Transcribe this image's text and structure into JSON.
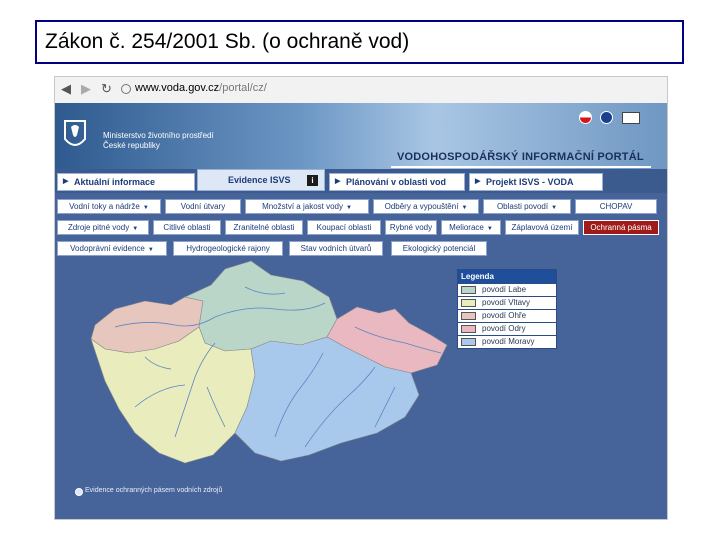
{
  "slide": {
    "title": "Zákon č. 254/2001 Sb. (o ochraně vod)"
  },
  "browser": {
    "address_host": "www.voda.gov.cz",
    "address_path": "/portal/cz/"
  },
  "header": {
    "ministry_line1": "Ministerstvo životního prostředí",
    "ministry_line2": "České republiky",
    "portal_title": "VODOHOSPODÁŘSKÝ INFORMAČNÍ PORTÁL"
  },
  "tabs": [
    {
      "label": "Aktuální informace"
    },
    {
      "label": "Evidence ISVS"
    },
    {
      "label": "Plánování v oblasti vod"
    },
    {
      "label": "Projekt ISVS - VODA"
    }
  ],
  "info_badge": "i",
  "buttons_row1": [
    "Vodní toky a nádrže",
    "Vodní útvary",
    "Množství a jakost vody",
    "Odběry a vypouštění",
    "Oblasti povodí",
    "CHOPAV"
  ],
  "buttons_row2": [
    "Zdroje pitné vody",
    "Citlivé oblasti",
    "Zranitelné oblasti",
    "Koupací oblasti",
    "Rybné vody",
    "Meliorace",
    "Záplavová území",
    "Ochranná pásma"
  ],
  "buttons_row3": [
    "Vodoprávní evidence",
    "Hydrogeologické rajony",
    "Stav vodních útvarů",
    "Ekologický potenciál"
  ],
  "legend": {
    "title": "Legenda",
    "items": [
      {
        "label": "povodí Labe",
        "color": "#b9d6c8"
      },
      {
        "label": "povodí Vltavy",
        "color": "#e9ecbd"
      },
      {
        "label": "povodí Ohře",
        "color": "#e6c6bd"
      },
      {
        "label": "povodí Odry",
        "color": "#e9b8c1"
      },
      {
        "label": "povodí Moravy",
        "color": "#a8c9ec"
      }
    ]
  },
  "map_colors": {
    "labe": "#b9d6c8",
    "vltava": "#e9ecbd",
    "ohre": "#e6c6bd",
    "odra": "#e9b8c1",
    "morava": "#a8c9ec",
    "river": "#5b84c4"
  },
  "footnote": "Evidence ochranných pásem vodních zdrojů"
}
